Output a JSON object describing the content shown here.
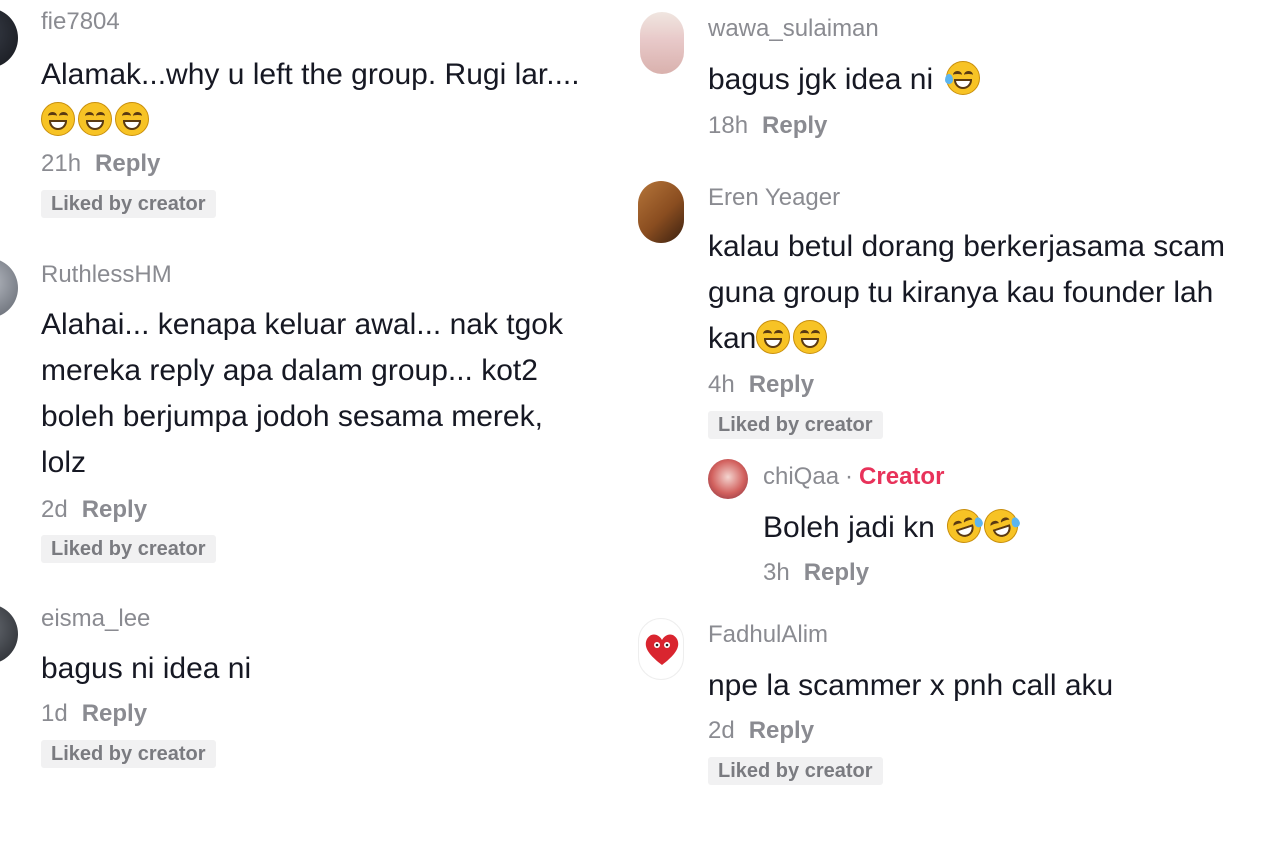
{
  "left_column": [
    {
      "username": "fie7804",
      "text_lines": [
        "Alamak...why u left the group. Rugi lar...."
      ],
      "emojis": [
        "grinning-sweat-emoji",
        "grinning-sweat-emoji",
        "grinning-sweat-emoji"
      ],
      "time": "21h",
      "reply": "Reply",
      "liked": "Liked by creator"
    },
    {
      "username": "RuthlessHM",
      "text_lines": [
        "Alahai... kenapa keluar awal... nak tgok",
        "mereka reply apa dalam group... kot2",
        "boleh berjumpa jodoh sesama merek,",
        "lolz"
      ],
      "time": "2d",
      "reply": "Reply",
      "liked": "Liked by creator"
    },
    {
      "username": "eisma_lee",
      "text_lines": [
        "bagus ni idea ni"
      ],
      "time": "1d",
      "reply": "Reply",
      "liked": "Liked by creator"
    }
  ],
  "right_column": [
    {
      "username": "wawa_sulaiman",
      "text_lines": [
        "bagus jgk idea ni"
      ],
      "emojis": [
        "grinning-sweat-emoji"
      ],
      "time": "18h",
      "reply": "Reply"
    },
    {
      "username": "Eren Yeager",
      "text_lines": [
        "kalau betul dorang berkerjasama scam",
        "guna group tu kiranya kau founder lah",
        "kan"
      ],
      "emojis": [
        "grinning-sweat-emoji",
        "grinning-sweat-emoji"
      ],
      "time": "4h",
      "reply": "Reply",
      "liked": "Liked by creator",
      "reply_thread": {
        "username": "chiQaa",
        "separator": "·",
        "badge": "Creator",
        "text": "Boleh jadi kn",
        "emojis": [
          "rolling-laughing-emoji",
          "rolling-laughing-emoji"
        ],
        "time": "3h",
        "reply": "Reply"
      }
    },
    {
      "username": "FadhulAlim",
      "text_lines": [
        "npe la scammer x pnh call aku"
      ],
      "time": "2d",
      "reply": "Reply",
      "liked": "Liked by creator"
    }
  ],
  "colors": {
    "text": "#161823",
    "muted": "#8a8b91",
    "creator_badge": "#e8325a",
    "liked_bg": "#f1f1f2"
  }
}
